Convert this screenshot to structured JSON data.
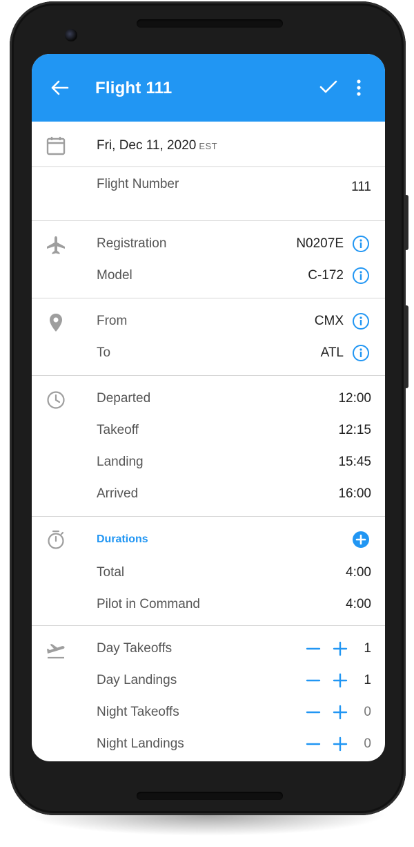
{
  "appbar": {
    "title": "Flight 111",
    "back_icon": "arrow-left-icon",
    "save_icon": "check-icon",
    "menu_icon": "more-vertical-icon"
  },
  "date": {
    "icon": "calendar-icon",
    "value": "Fri, Dec 11, 2020",
    "timezone": "EST"
  },
  "flight_number": {
    "label": "Flight Number",
    "value": "111"
  },
  "aircraft": {
    "icon": "airplane-icon",
    "registration_label": "Registration",
    "registration_value": "N0207E",
    "model_label": "Model",
    "model_value": "C-172"
  },
  "route": {
    "icon": "location-pin-icon",
    "from_label": "From",
    "from_value": "CMX",
    "to_label": "To",
    "to_value": "ATL"
  },
  "times": {
    "icon": "clock-icon",
    "departed_label": "Departed",
    "departed_value": "12:00",
    "takeoff_label": "Takeoff",
    "takeoff_value": "12:15",
    "landing_label": "Landing",
    "landing_value": "15:45",
    "arrived_label": "Arrived",
    "arrived_value": "16:00"
  },
  "durations": {
    "icon": "stopwatch-icon",
    "title": "Durations",
    "total_label": "Total",
    "total_value": "4:00",
    "pic_label": "Pilot in Command",
    "pic_value": "4:00"
  },
  "landings": {
    "icon": "flight-takeoff-icon",
    "day_takeoffs_label": "Day Takeoffs",
    "day_takeoffs_value": "1",
    "day_landings_label": "Day Landings",
    "day_landings_value": "1",
    "night_takeoffs_label": "Night Takeoffs",
    "night_takeoffs_value": "0",
    "night_landings_label": "Night Landings",
    "night_landings_value": "0"
  },
  "colors": {
    "primary": "#2196f3",
    "icon_gray": "#9e9e9e",
    "divider": "#d6d6d6"
  }
}
